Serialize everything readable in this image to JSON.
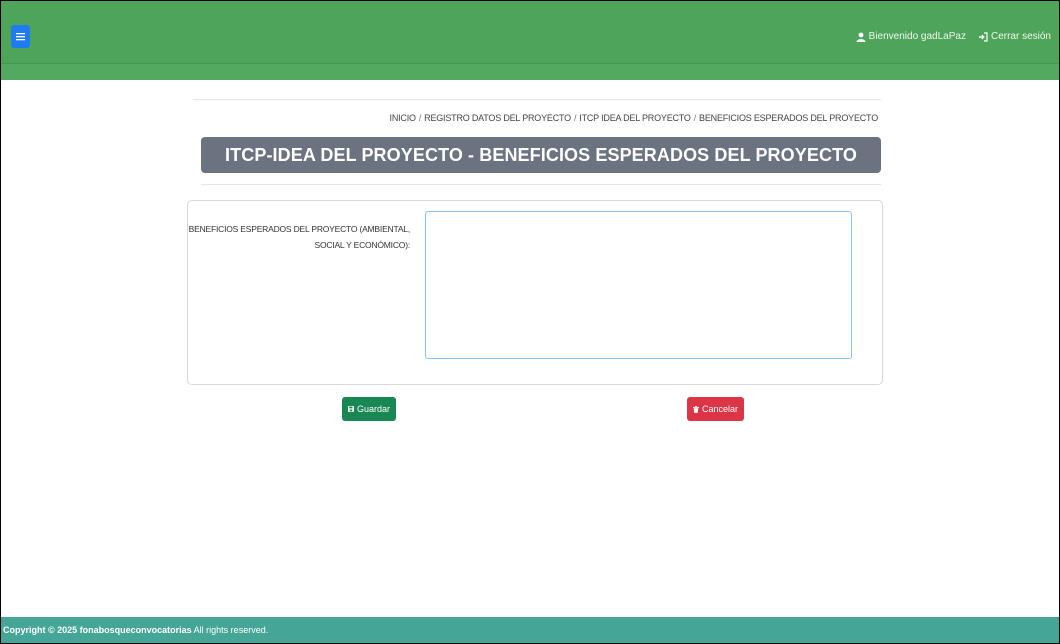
{
  "header": {
    "menu_icon": "bars-icon",
    "welcome": "Bienvenido gadLaPaz",
    "welcome_icon": "user-icon",
    "logout": "Cerrar sesión",
    "logout_icon": "sign-out-icon"
  },
  "breadcrumb": {
    "items": [
      "INICIO",
      "REGISTRO DATOS DEL PROYECTO",
      "ITCP IDEA DEL PROYECTO",
      "BENEFICIOS ESPERADOS DEL PROYECTO"
    ],
    "separator": "/"
  },
  "page_title": "ITCP-IDEA DEL PROYECTO - BENEFICIOS ESPERADOS DEL PROYECTO",
  "form": {
    "label_line1": "BENEFICIOS ESPERADOS DEL PROYECTO (AMBIENTAL,",
    "label_line2": "SOCIAL Y ECONÓMICO):",
    "value": ""
  },
  "buttons": {
    "save": "Guardar",
    "save_icon": "save-icon",
    "cancel": "Cancelar",
    "cancel_icon": "trash-icon"
  },
  "footer": {
    "copyright": "Copyright © 2025 fonabosqueconvocatorias",
    "rights": " All rights reserved."
  },
  "colors": {
    "navbar": "#4ea55a",
    "title_bar": "#6b7280",
    "save": "#198754",
    "cancel": "#dc3545",
    "footer": "#45a697"
  }
}
